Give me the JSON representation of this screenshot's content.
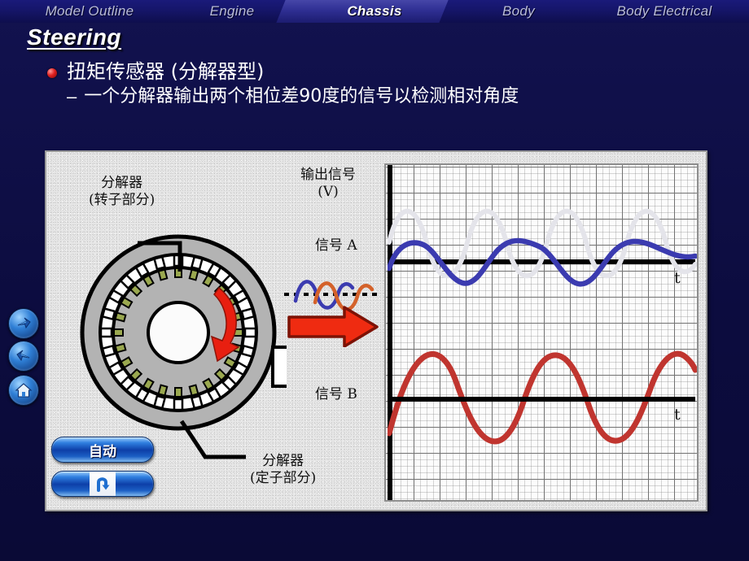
{
  "tabs": [
    {
      "label": "Model Outline",
      "active": false
    },
    {
      "label": "Engine",
      "active": false
    },
    {
      "label": "Chassis",
      "active": true
    },
    {
      "label": "Body",
      "active": false
    },
    {
      "label": "Body Electrical",
      "active": false
    }
  ],
  "slide": {
    "title": "Steering",
    "bullet_level1": "扭矩传感器 (分解器型)",
    "bullet_level2_dash": "–",
    "bullet_level2": "一个分解器输出两个相位差90度的信号以检测相对角度"
  },
  "nav": {
    "forward": "forward-arrow-icon",
    "back": "back-arrow-icon",
    "home": "home-icon"
  },
  "diagram": {
    "label_rotor_line1": "分解器",
    "label_rotor_line2": "(转子部分)",
    "label_stator_line1": "分解器",
    "label_stator_line2": "(定子部分)",
    "label_output_line1": "输出信号",
    "label_output_line2": "(V)",
    "label_signal_a": "信号 A",
    "label_signal_b": "信号 B",
    "rotation_arrow": "rotation-arrow-icon",
    "transfer_arrow": "red-right-arrow-icon"
  },
  "controls": {
    "auto_label": "自动",
    "replay_icon": "replay-loop-icon"
  },
  "chart_data": {
    "type": "line",
    "title": "输出信号 (V)",
    "xlabel": "t",
    "ylabel": "V",
    "grid": true,
    "legend": false,
    "panels": [
      {
        "name": "信号 A",
        "baseline_label": "t",
        "series": [
          {
            "name": "Signal A",
            "color": "#3b3bb0",
            "amplitude": 28,
            "cycles": 3.0,
            "phase_deg": 200,
            "width": 6
          },
          {
            "name": "Signal A reference (ghost)",
            "color": "#e3e3ea",
            "amplitude": 58,
            "cycles": 3.0,
            "phase_deg": 110,
            "width": 6
          }
        ]
      },
      {
        "name": "信号 B",
        "baseline_label": "t",
        "series": [
          {
            "name": "Signal B",
            "color": "#c0352f",
            "amplitude": 62,
            "cycles": 2.6,
            "phase_deg": 200,
            "width": 7
          }
        ]
      }
    ],
    "phase_difference_deg": 90
  },
  "colors": {
    "background": "#0d0d4a",
    "tab_active": "#ffffff",
    "tab_inactive": "#b9bcd8",
    "signal_a": "#3b3bb0",
    "signal_b": "#c0352f",
    "accent_red": "#e02020",
    "panel": "#e6e6e6"
  }
}
